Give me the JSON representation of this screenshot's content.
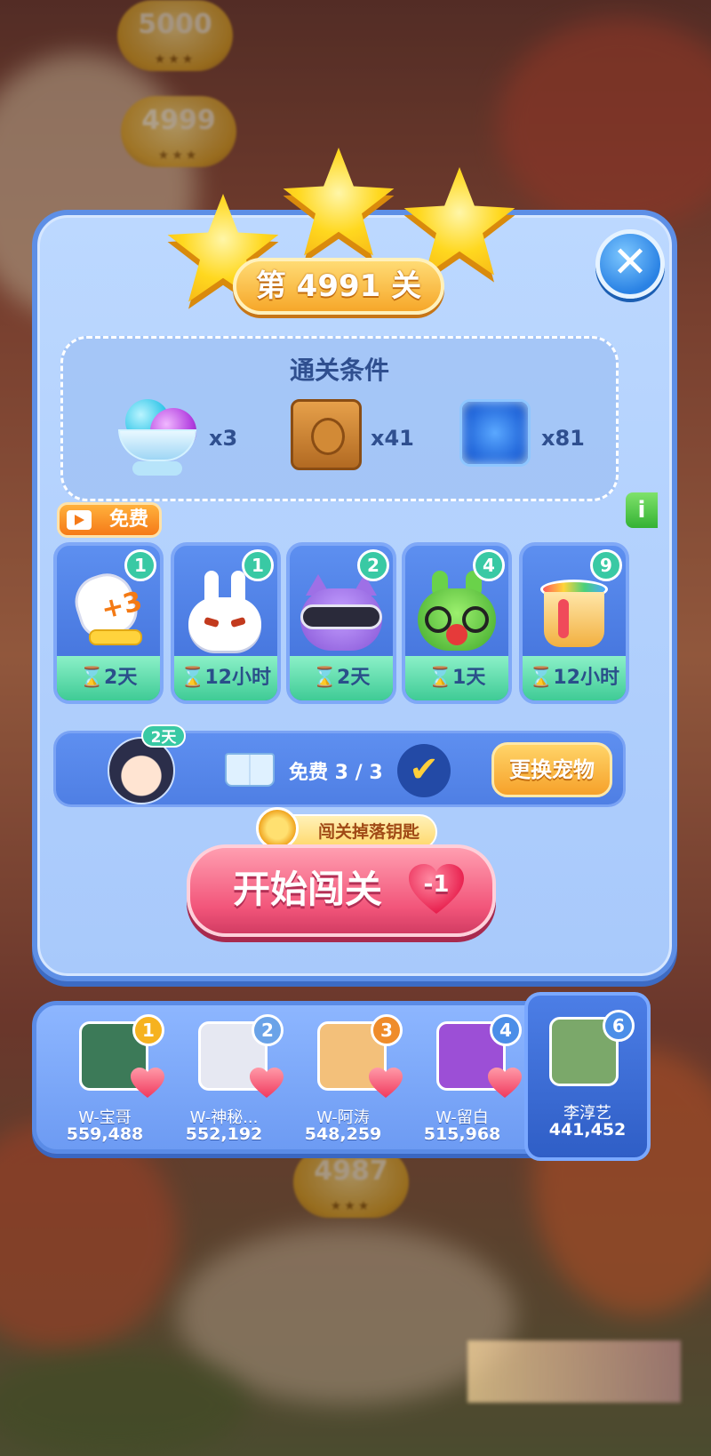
{
  "background": {
    "coins": [
      "5000",
      "4999",
      "4987"
    ]
  },
  "level": {
    "title": "第 4991 关",
    "stars_earned": 3,
    "stars_total": 3
  },
  "conditions": {
    "title": "通关条件",
    "items": [
      {
        "icon": "jelly-ball-icon",
        "count": "x3"
      },
      {
        "icon": "fruit-crate-icon",
        "count": "x41"
      },
      {
        "icon": "ice-block-icon",
        "count": "x81"
      }
    ]
  },
  "free_tag": "免费",
  "info_label": "i",
  "close_label": "✕",
  "boosters": [
    {
      "icon": "glove-plus3-icon",
      "count": "1",
      "timer": "⌛2天",
      "art": "+3"
    },
    {
      "icon": "white-bunny-icon",
      "count": "1",
      "timer": "⌛12小时",
      "art": ""
    },
    {
      "icon": "purple-cat-goggles-icon",
      "count": "2",
      "timer": "⌛2天",
      "art": ""
    },
    {
      "icon": "green-frog-icon",
      "count": "4",
      "timer": "⌛1天",
      "art": ""
    },
    {
      "icon": "paint-bucket-icon",
      "count": "9",
      "timer": "⌛12小时",
      "art": ""
    }
  ],
  "pet": {
    "badge": "2天",
    "free_count": "免费 3 / 3",
    "check": "✔",
    "change_label": "更换宠物"
  },
  "drop_tag": "闯关掉落钥匙",
  "start": {
    "label": "开始闯关",
    "cost": "-1"
  },
  "leaderboard": [
    {
      "rank": "1",
      "name": "W-宝哥",
      "score": "559,488",
      "rank_color": "#f6b21f",
      "thumb_color": "#3c7a58"
    },
    {
      "rank": "2",
      "name": "W-神秘...",
      "score": "552,192",
      "rank_color": "#6aa3e8",
      "thumb_color": "#e6e8f2"
    },
    {
      "rank": "3",
      "name": "W-阿涛",
      "score": "548,259",
      "rank_color": "#ef8c2a",
      "thumb_color": "#f3c07a"
    },
    {
      "rank": "4",
      "name": "W-留白",
      "score": "515,968",
      "rank_color": "#4b8ee8",
      "thumb_color": "#9c4fd6"
    },
    {
      "rank": "6",
      "name": "李淳艺",
      "score": "441,452",
      "rank_color": "#4b8ee8",
      "thumb_color": "#7ba86a"
    }
  ]
}
